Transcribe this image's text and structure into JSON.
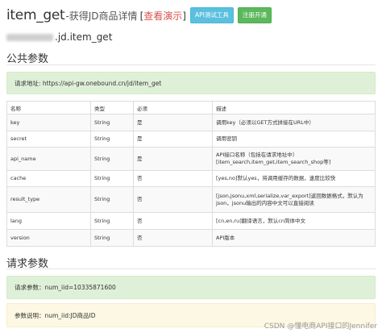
{
  "header": {
    "title": "item_get",
    "subtitle": "-获得JD商品详情",
    "demo_link_open": "[",
    "demo_link": "查看演示",
    "demo_link_close": "]",
    "api_test_button": "API测试工具",
    "register_button": "注册开通"
  },
  "api_name_suffix": ".jd.item_get",
  "public_params": {
    "heading": "公共参数",
    "request_url": "请求地址: https://api-gw.onebound.cn/jd/item_get",
    "columns": [
      "名称",
      "类型",
      "必须",
      "描述"
    ],
    "rows": [
      {
        "name": "key",
        "type": "String",
        "required": "是",
        "desc": "调用key（必须以GET方式拼接在URL中）"
      },
      {
        "name": "secret",
        "type": "String",
        "required": "是",
        "desc": "调用密钥"
      },
      {
        "name": "api_name",
        "type": "String",
        "required": "是",
        "desc": "API接口名称（包括在请求地址中）[item_search,item_get,item_search_shop等]"
      },
      {
        "name": "cache",
        "type": "String",
        "required": "否",
        "desc": "[yes,no]默认yes，将调用缓存的数据，速度比较快"
      },
      {
        "name": "result_type",
        "type": "String",
        "required": "否",
        "desc": "[json,jsonu,xml,serialize,var_export]返回数据格式，默认为json，jsonu输出的内容中文可以直接阅读"
      },
      {
        "name": "lang",
        "type": "String",
        "required": "否",
        "desc": "[cn,en,ru]翻译语言，默认cn简体中文"
      },
      {
        "name": "version",
        "type": "String",
        "required": "否",
        "desc": "API版本"
      }
    ]
  },
  "request_params": {
    "heading": "请求参数",
    "example": "请求参数：num_iid=10335871600",
    "description": "参数说明：num_iid:JD商品ID"
  },
  "watermark": "CSDN @懂电商API接口的Jennifer"
}
